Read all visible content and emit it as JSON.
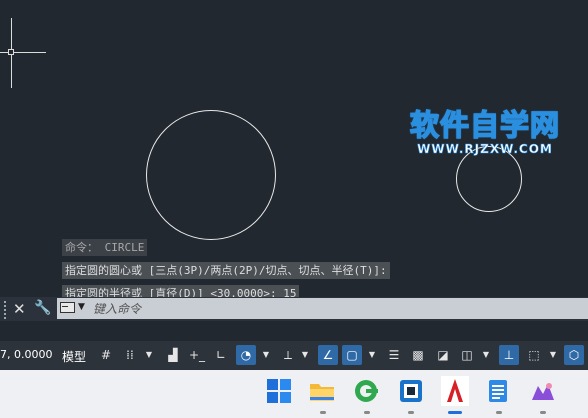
{
  "watermark": {
    "title": "软件自学网",
    "url": "WWW.RJZXW.COM"
  },
  "command_history": [
    "命令： CIRCLE",
    "指定圆的圆心或 [三点(3P)/两点(2P)/切点、切点、半径(T)]:",
    "指定圆的半径或 [直径(D)] <30.0000>: 15"
  ],
  "command_line": {
    "placeholder": "键入命令"
  },
  "status_bar": {
    "coordinates": "7, 0.0000",
    "model_label": "模型"
  },
  "taskbar_apps": [
    "windows-start",
    "file-explorer",
    "browser",
    "image-viewer",
    "autocad",
    "notepad",
    "app"
  ],
  "colors": {
    "canvas": "#212830",
    "accent": "#2f6aa6",
    "watermark": "#2b8fe0"
  }
}
